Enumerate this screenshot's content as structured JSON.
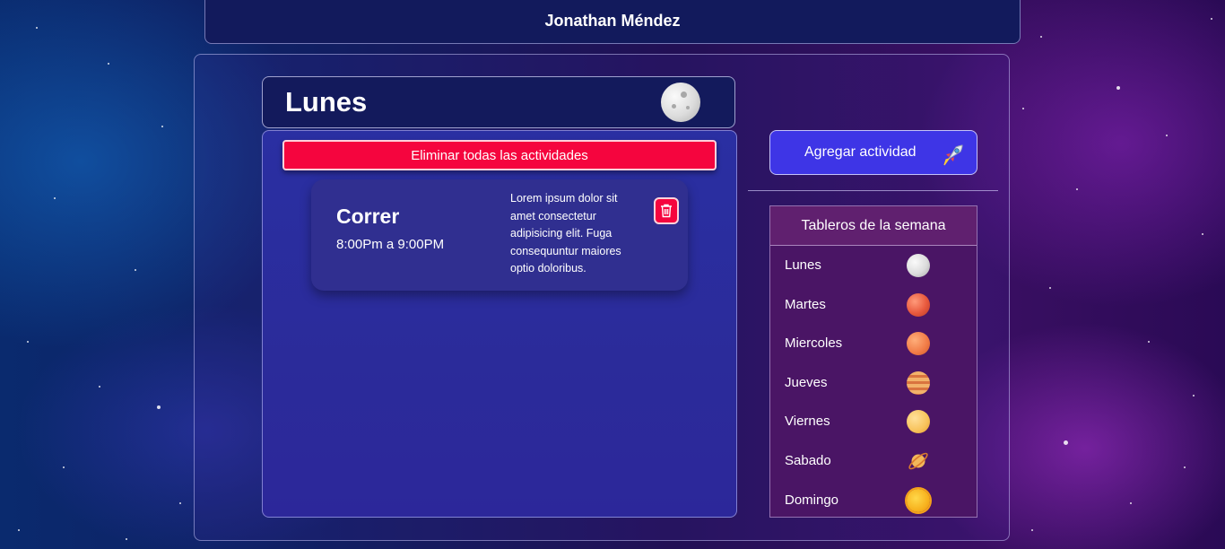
{
  "header": {
    "user_name": "Jonathan Méndez"
  },
  "current_day": {
    "title": "Lunes",
    "icon": "moon-icon"
  },
  "actions": {
    "clear_all_label": "Eliminar todas las actividades",
    "add_activity_label": "Agregar actividad",
    "add_activity_icon": "rocket-icon"
  },
  "activities": [
    {
      "title": "Correr",
      "time": "8:00Pm a 9:00PM",
      "description": "Lorem ipsum dolor sit amet consectetur adipisicing elit. Fuga consequuntur maiores optio doloribus."
    }
  ],
  "week_boards": {
    "title": "Tableros de la semana",
    "days": [
      {
        "label": "Lunes",
        "icon": "moon-icon"
      },
      {
        "label": "Martes",
        "icon": "mars-planet-icon"
      },
      {
        "label": "Miercoles",
        "icon": "mercury-planet-icon"
      },
      {
        "label": "Jueves",
        "icon": "jupiter-planet-icon"
      },
      {
        "label": "Viernes",
        "icon": "venus-planet-icon"
      },
      {
        "label": "Sabado",
        "icon": "saturn-planet-icon"
      },
      {
        "label": "Domingo",
        "icon": "sun-icon"
      }
    ]
  },
  "colors": {
    "danger": "#f5053e",
    "primary": "#3e35e6",
    "panel_dark": "#131a5c",
    "week_panel": "#4a1565"
  }
}
